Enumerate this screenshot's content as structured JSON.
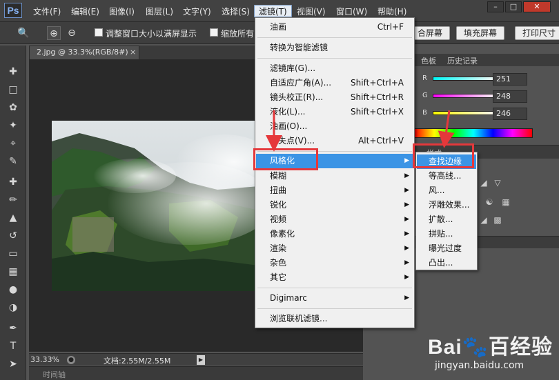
{
  "app": {
    "logo": "Ps"
  },
  "menubar": {
    "items": [
      "文件(F)",
      "编辑(E)",
      "图像(I)",
      "图层(L)",
      "文字(Y)",
      "选择(S)",
      "滤镜(T)",
      "视图(V)",
      "窗口(W)",
      "帮助(H)"
    ],
    "active_item": "滤镜(T)"
  },
  "window_controls": {
    "minimize": "–",
    "maximize": "□",
    "close": "✕"
  },
  "options_bar": {
    "resize_window_label": "调整窗口大小以满屏显示",
    "zoom_all_label": "缩放所有",
    "fit_screen_btn": "合屏幕",
    "fill_screen_btn": "填充屏幕",
    "print_size_btn": "打印尺寸"
  },
  "document": {
    "tab_title": "2.jpg @ 33.3%(RGB/8#)",
    "tab_close": "×"
  },
  "status_bar": {
    "zoom": "33.33%",
    "doc_size": "文档:2.55M/2.55M"
  },
  "timeline": {
    "label": "时间轴"
  },
  "panels": {
    "tabs": [
      "色板",
      "历史记录"
    ],
    "color": {
      "r_label": "R",
      "r_value": "251",
      "g_label": "G",
      "g_value": "248",
      "b_label": "B",
      "b_value": "246"
    },
    "panel2_title": "样式"
  },
  "filter_menu": {
    "items": [
      {
        "label": "油画",
        "shortcut": "Ctrl+F"
      },
      {
        "label": "转换为智能滤镜"
      },
      {
        "label": "滤镜库(G)..."
      },
      {
        "label": "自适应广角(A)...",
        "shortcut": "Shift+Ctrl+A"
      },
      {
        "label": "镜头校正(R)...",
        "shortcut": "Shift+Ctrl+R"
      },
      {
        "label": "液化(L)...",
        "shortcut": "Shift+Ctrl+X"
      },
      {
        "label": "油画(O)..."
      },
      {
        "label": "消失点(V)...",
        "shortcut": "Alt+Ctrl+V"
      },
      {
        "label": "风格化",
        "submenu": "▶"
      },
      {
        "label": "模糊",
        "submenu": "▶"
      },
      {
        "label": "扭曲",
        "submenu": "▶"
      },
      {
        "label": "锐化",
        "submenu": "▶"
      },
      {
        "label": "视频",
        "submenu": "▶"
      },
      {
        "label": "像素化",
        "submenu": "▶"
      },
      {
        "label": "渲染",
        "submenu": "▶"
      },
      {
        "label": "杂色",
        "submenu": "▶"
      },
      {
        "label": "其它",
        "submenu": "▶"
      },
      {
        "label": "Digimarc",
        "submenu": "▶"
      },
      {
        "label": "浏览联机滤镜..."
      }
    ],
    "highlighted": "风格化"
  },
  "style_submenu": {
    "items": [
      "查找边缘",
      "等高线...",
      "风...",
      "浮雕效果...",
      "扩散...",
      "拼贴...",
      "曝光过度",
      "凸出..."
    ],
    "highlighted": "查找边缘"
  },
  "watermark": {
    "brand": "Bai🐾百经验",
    "url": "jingyan.baidu.com"
  },
  "colors": {
    "highlight": "#3b94e5",
    "annotation": "#e5383b"
  }
}
